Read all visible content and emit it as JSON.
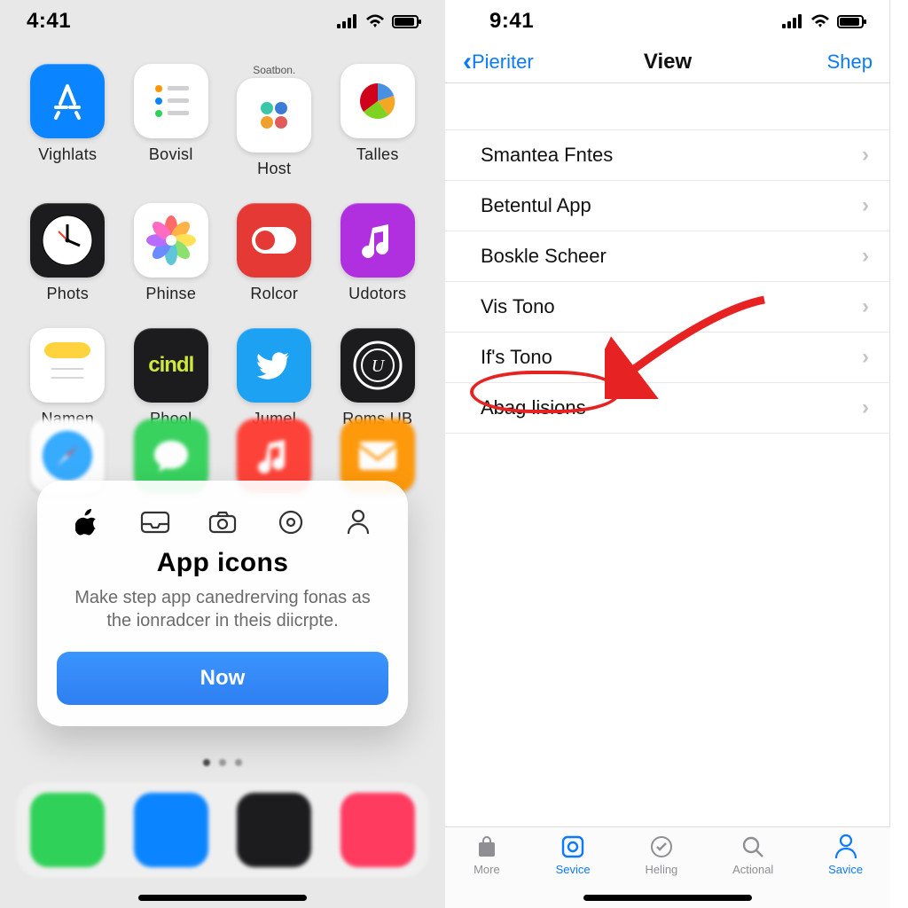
{
  "left": {
    "status_time": "4:41",
    "apps": [
      {
        "label": "Vighlats",
        "bg": "#0a84ff",
        "glyph": "appstore"
      },
      {
        "label": "Bovisl",
        "bg": "#ffffff",
        "glyph": "reminders"
      },
      {
        "label": "Host",
        "bg": "#ffffff",
        "glyph": "dots",
        "caption": "Soatbon."
      },
      {
        "label": "Talles",
        "bg": "#ffffff",
        "glyph": "pie"
      },
      {
        "label": "Phots",
        "bg": "#1c1c1e",
        "glyph": "clock"
      },
      {
        "label": "Phinse",
        "bg": "#ffffff",
        "glyph": "flower"
      },
      {
        "label": "Rolcor",
        "bg": "#e53935",
        "glyph": "toggle"
      },
      {
        "label": "Udotors",
        "bg": "#b030e0",
        "glyph": "music"
      },
      {
        "label": "Namen",
        "bg": "#ffffff",
        "glyph": "notes"
      },
      {
        "label": "Phool",
        "bg": "#1c1c1e",
        "glyph": "cindl",
        "caption_color": "#cfe83b"
      },
      {
        "label": "Jumel",
        "bg": "#1da1f2",
        "glyph": "twitter"
      },
      {
        "label": "Roms UB",
        "bg": "#1c1c1e",
        "glyph": "seal"
      }
    ],
    "blurred_row": [
      {
        "bg": "#ffffff",
        "glyph": "safari"
      },
      {
        "bg": "#30d158",
        "glyph": "msg"
      },
      {
        "bg": "#ff3b30",
        "glyph": "music"
      },
      {
        "bg": "#ff9500",
        "glyph": "mail"
      }
    ],
    "popup": {
      "icons": [
        "apple",
        "tray",
        "camera",
        "target",
        "person"
      ],
      "title": "App icons",
      "body": "Make step app canedrerving fonas as the ionradcer in theis diicrpte.",
      "button": "Now"
    },
    "pager_index": 0,
    "pager_total": 3
  },
  "right": {
    "status_time": "9:41",
    "navbar": {
      "back": "Pieriter",
      "title": "View",
      "action": "Shep"
    },
    "rows": [
      "Smantea Fntes",
      "Betentul App",
      "Boskle Scheer",
      "Vis Tono",
      "If's Tono",
      "Abag lisions"
    ],
    "highlight_index": 5,
    "tabs": [
      {
        "label": "More",
        "glyph": "bag"
      },
      {
        "label": "Sevice",
        "glyph": "square-o",
        "active": true
      },
      {
        "label": "Heling",
        "glyph": "check"
      },
      {
        "label": "Actional",
        "glyph": "search"
      },
      {
        "label": "Savice",
        "glyph": "person",
        "active": true
      }
    ]
  },
  "colors": {
    "ios_blue": "#0a7aff",
    "annot_red": "#e62222"
  }
}
